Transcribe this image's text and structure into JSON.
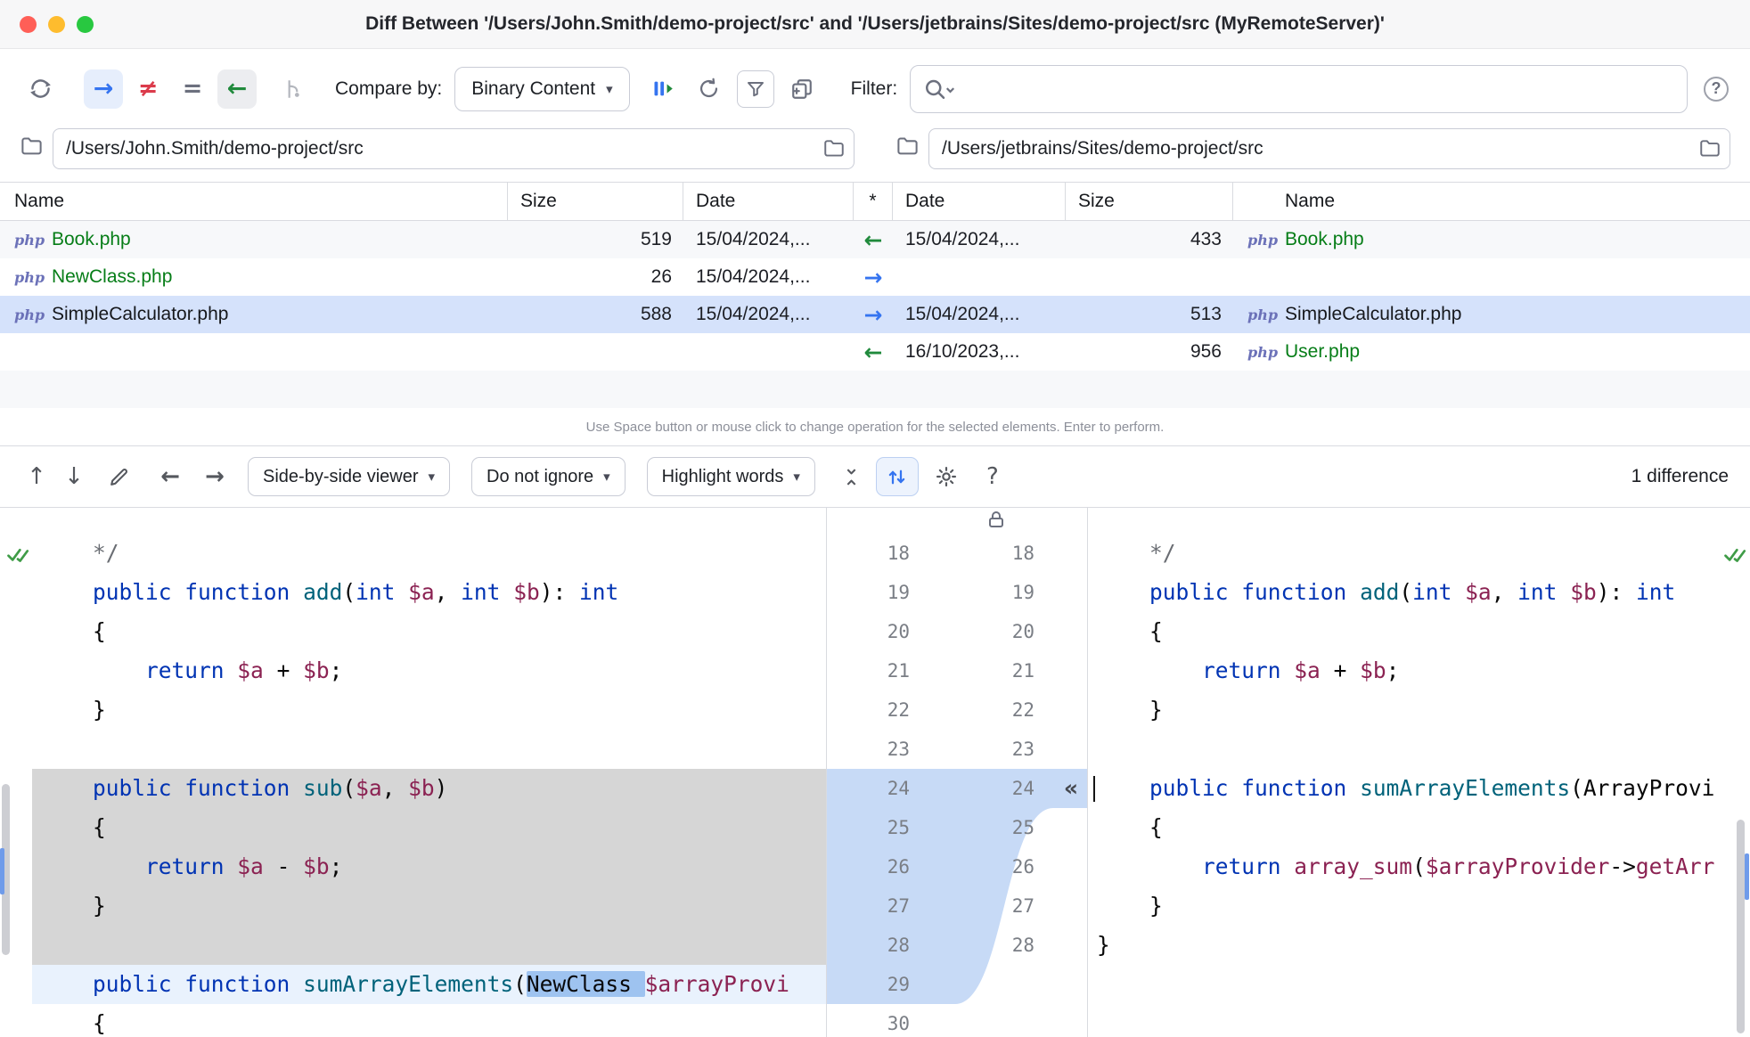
{
  "window": {
    "title": "Diff Between '/Users/John.Smith/demo-project/src' and '/Users/jetbrains/Sites/demo-project/src (MyRemoteServer)'"
  },
  "toolbar": {
    "compare_by_label": "Compare by:",
    "compare_by_value": "Binary Content",
    "filter_label": "Filter:",
    "search_placeholder": ""
  },
  "paths": {
    "left": "/Users/John.Smith/demo-project/src",
    "right": "/Users/jetbrains/Sites/demo-project/src"
  },
  "table": {
    "headers": {
      "left_name": "Name",
      "left_size": "Size",
      "left_date": "Date",
      "star": "*",
      "right_date": "Date",
      "right_size": "Size",
      "right_name": "Name"
    },
    "rows": [
      {
        "selected": false,
        "zebra": true,
        "left_php": true,
        "left_name": "Book.php",
        "left_size": "519",
        "left_date": "15/04/2024,...",
        "arrow": "left",
        "right_date": "15/04/2024,...",
        "right_size": "433",
        "right_php": true,
        "right_name": "Book.php",
        "green": true
      },
      {
        "selected": false,
        "zebra": false,
        "left_php": true,
        "left_name": "NewClass.php",
        "left_size": "26",
        "left_date": "15/04/2024,...",
        "arrow": "right",
        "right_date": "",
        "right_size": "",
        "right_php": false,
        "right_name": "",
        "green": true
      },
      {
        "selected": true,
        "zebra": false,
        "left_php": true,
        "left_name": "SimpleCalculator.php",
        "left_size": "588",
        "left_date": "15/04/2024,...",
        "arrow": "right",
        "right_date": "15/04/2024,...",
        "right_size": "513",
        "right_php": true,
        "right_name": "SimpleCalculator.php",
        "green": false
      },
      {
        "selected": false,
        "zebra": false,
        "left_php": false,
        "left_name": "",
        "left_size": "",
        "left_date": "",
        "arrow": "left",
        "right_date": "16/10/2023,...",
        "right_size": "956",
        "right_php": true,
        "right_name": "User.php",
        "green": true
      },
      {
        "selected": false,
        "zebra": true,
        "left_php": false,
        "left_name": "",
        "left_size": "",
        "left_date": "",
        "arrow": "",
        "right_date": "",
        "right_size": "",
        "right_php": false,
        "right_name": "",
        "green": false
      }
    ]
  },
  "hint": "Use Space button or mouse click to change operation for the selected elements. Enter to perform.",
  "diff_toolbar": {
    "viewer_dropdown": "Side-by-side viewer",
    "whitespace_dropdown": "Do not ignore",
    "highlight_dropdown": "Highlight words",
    "differences": "1 difference"
  },
  "icons": {
    "arrow_right": "→",
    "arrow_left": "←",
    "not_equal": "≠",
    "equals": "=",
    "chevron_down": "▾",
    "up_arrow": "↑",
    "down_arrow": "↓",
    "apply_chevrons": "«",
    "question_mark": "?",
    "php_badge": "php"
  },
  "editor": {
    "left": [
      {
        "n": "18",
        "t": [
          [
            "    */",
            "c"
          ]
        ]
      },
      {
        "n": "19",
        "t": [
          [
            "    ",
            "p"
          ],
          [
            "public",
            "k"
          ],
          [
            " ",
            "p"
          ],
          [
            "function",
            "k"
          ],
          [
            " ",
            "p"
          ],
          [
            "add",
            "f"
          ],
          [
            "(",
            "p"
          ],
          [
            "int",
            "k"
          ],
          [
            " ",
            "p"
          ],
          [
            "$a",
            "v"
          ],
          [
            ", ",
            "p"
          ],
          [
            "int",
            "k"
          ],
          [
            " ",
            "p"
          ],
          [
            "$b",
            "v"
          ],
          [
            "): ",
            "p"
          ],
          [
            "int",
            "k"
          ]
        ]
      },
      {
        "n": "20",
        "t": [
          [
            "    {",
            "p"
          ]
        ]
      },
      {
        "n": "21",
        "t": [
          [
            "        ",
            "p"
          ],
          [
            "return",
            "k"
          ],
          [
            " ",
            "p"
          ],
          [
            "$a",
            "v"
          ],
          [
            " + ",
            "p"
          ],
          [
            "$b",
            "v"
          ],
          [
            ";",
            "p"
          ]
        ]
      },
      {
        "n": "22",
        "t": [
          [
            "    }",
            "p"
          ]
        ]
      },
      {
        "n": "23",
        "t": []
      },
      {
        "n": "24",
        "bg": "del",
        "t": [
          [
            "    ",
            "p"
          ],
          [
            "public",
            "k"
          ],
          [
            " ",
            "p"
          ],
          [
            "function",
            "k"
          ],
          [
            " ",
            "p"
          ],
          [
            "sub",
            "f"
          ],
          [
            "(",
            "p"
          ],
          [
            "$a",
            "v"
          ],
          [
            ", ",
            "p"
          ],
          [
            "$b",
            "v"
          ],
          [
            ")",
            "p"
          ]
        ]
      },
      {
        "n": "25",
        "bg": "del",
        "t": [
          [
            "    {",
            "p"
          ]
        ]
      },
      {
        "n": "26",
        "bg": "del",
        "t": [
          [
            "        ",
            "p"
          ],
          [
            "return",
            "k"
          ],
          [
            " ",
            "p"
          ],
          [
            "$a",
            "v"
          ],
          [
            " - ",
            "p"
          ],
          [
            "$b",
            "v"
          ],
          [
            ";",
            "p"
          ]
        ]
      },
      {
        "n": "27",
        "bg": "del",
        "t": [
          [
            "    }",
            "p"
          ]
        ]
      },
      {
        "n": "28",
        "bg": "del",
        "t": []
      },
      {
        "n": "29",
        "bg": "mod",
        "t": [
          [
            "    ",
            "p"
          ],
          [
            "public",
            "k"
          ],
          [
            " ",
            "p"
          ],
          [
            "function",
            "k"
          ],
          [
            " ",
            "p"
          ],
          [
            "sumArrayElements",
            "f"
          ],
          [
            "(",
            "p"
          ],
          [
            "NewClass ",
            "w"
          ],
          [
            "$arrayProvi",
            "v"
          ]
        ]
      },
      {
        "n": "30",
        "t": [
          [
            "    {",
            "p"
          ]
        ]
      }
    ],
    "right": [
      {
        "n": "18",
        "t": [
          [
            "    */",
            "c"
          ]
        ]
      },
      {
        "n": "19",
        "t": [
          [
            "    ",
            "p"
          ],
          [
            "public",
            "k"
          ],
          [
            " ",
            "p"
          ],
          [
            "function",
            "k"
          ],
          [
            " ",
            "p"
          ],
          [
            "add",
            "f"
          ],
          [
            "(",
            "p"
          ],
          [
            "int",
            "k"
          ],
          [
            " ",
            "p"
          ],
          [
            "$a",
            "v"
          ],
          [
            ", ",
            "p"
          ],
          [
            "int",
            "k"
          ],
          [
            " ",
            "p"
          ],
          [
            "$b",
            "v"
          ],
          [
            "): ",
            "p"
          ],
          [
            "int",
            "k"
          ]
        ]
      },
      {
        "n": "20",
        "t": [
          [
            "    {",
            "p"
          ]
        ]
      },
      {
        "n": "21",
        "t": [
          [
            "        ",
            "p"
          ],
          [
            "return",
            "k"
          ],
          [
            " ",
            "p"
          ],
          [
            "$a",
            "v"
          ],
          [
            " + ",
            "p"
          ],
          [
            "$b",
            "v"
          ],
          [
            ";",
            "p"
          ]
        ]
      },
      {
        "n": "22",
        "t": [
          [
            "    }",
            "p"
          ]
        ]
      },
      {
        "n": "23",
        "t": []
      },
      {
        "n": "24",
        "caret": true,
        "chev": true,
        "t": [
          [
            "    ",
            "p"
          ],
          [
            "public",
            "k"
          ],
          [
            " ",
            "p"
          ],
          [
            "function",
            "k"
          ],
          [
            " ",
            "p"
          ],
          [
            "sumArrayElements",
            "f"
          ],
          [
            "(",
            "p"
          ],
          [
            "ArrayProvi",
            "p"
          ]
        ]
      },
      {
        "n": "25",
        "t": [
          [
            "    {",
            "p"
          ]
        ]
      },
      {
        "n": "26",
        "t": [
          [
            "        ",
            "p"
          ],
          [
            "return",
            "k"
          ],
          [
            " ",
            "p"
          ],
          [
            "array_sum",
            "v"
          ],
          [
            "(",
            "p"
          ],
          [
            "$arrayProvider",
            "v"
          ],
          [
            "->",
            "p"
          ],
          [
            "getArr",
            "v"
          ]
        ]
      },
      {
        "n": "27",
        "t": [
          [
            "    }",
            "p"
          ]
        ]
      },
      {
        "n": "28",
        "t": [
          [
            "}",
            "p"
          ]
        ]
      }
    ]
  },
  "colors": {
    "accent_blue": "#3574f0",
    "arrow_green": "#208a3c",
    "neq_red": "#db3b4b",
    "file_green": "#067d17",
    "selected_row": "#d5e2fb",
    "zebra_row": "#f7f8fa",
    "deleted_line_bg": "#d6d6d6",
    "changed_line_bg": "#e9f2fd",
    "word_diff_bg": "#9ec3f0",
    "spline_fill": "#c7daf6",
    "syntax_keyword": "#0033b3",
    "syntax_function": "#00627a",
    "syntax_variable": "#8b2252",
    "syntax_comment": "#6a6d73",
    "syntax_plain": "#080808",
    "line_number": "#7a7e85",
    "php_icon": "#6b71b8"
  }
}
